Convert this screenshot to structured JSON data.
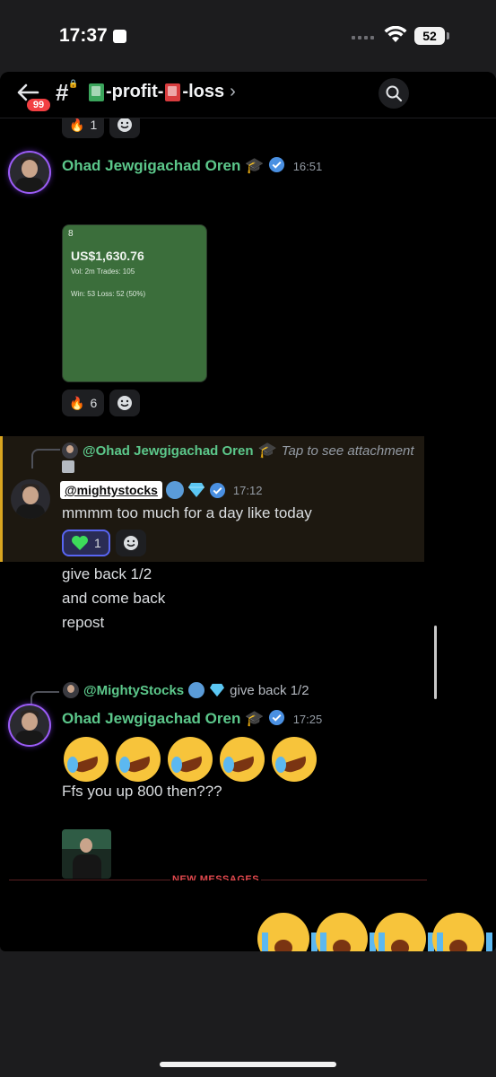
{
  "status_bar": {
    "time": "17:37",
    "battery": "52"
  },
  "header": {
    "unread_count": "99",
    "channel_prefix": "-profit-",
    "channel_suffix": "-loss",
    "chevron": "›"
  },
  "top_reactions": {
    "count": "1"
  },
  "message_1": {
    "author": "Ohad Jewgigachad Oren",
    "time": "16:51",
    "card": {
      "index": "8",
      "amount": "US$1,630.76",
      "volume_line": "Vol: 2m Trades: 105",
      "win_line": "Win: 53 Loss: 52 (50%)"
    },
    "reactions": [
      {
        "emoji": "fire",
        "count": "6"
      }
    ]
  },
  "message_2": {
    "reply_to_name": "@Ohad Jewgigachad Oren",
    "reply_note": "Tap to see attachment",
    "author": "@mightystocks",
    "time": "17:12",
    "text": "mmmm too much for a day like today",
    "reactions": [
      {
        "emoji": "green-heart",
        "count": "1"
      }
    ]
  },
  "followups": [
    "give back 1/2",
    "and come back",
    "repost"
  ],
  "message_3": {
    "reply_to_name": "@MightyStocks",
    "reply_snippet": "give back 1/2",
    "author": "Ohad Jewgigachad Oren",
    "time": "17:25",
    "emoji_count": 5,
    "text": "Ffs you up 800 then???"
  },
  "divider": {
    "label": "NEW MESSAGES"
  },
  "cry_emoji_count": 4,
  "colors": {
    "author_green": "#5cc88b",
    "highlight_border": "#d9a520",
    "new_messages_red": "#e0484d",
    "card_green": "#3b6e3b"
  }
}
